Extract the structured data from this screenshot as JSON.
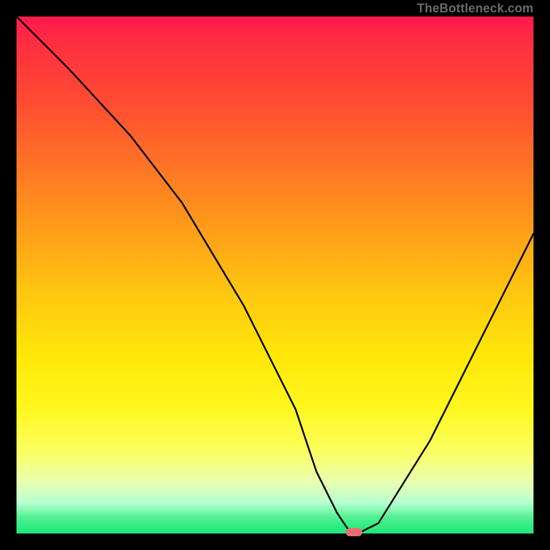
{
  "watermark": "TheBottleneck.com",
  "chart_data": {
    "type": "line",
    "title": "",
    "xlabel": "",
    "ylabel": "",
    "xlim": [
      0,
      100
    ],
    "ylim": [
      0,
      100
    ],
    "grid": false,
    "legend": false,
    "series": [
      {
        "name": "curve",
        "x": [
          0,
          10,
          22,
          32,
          44,
          54,
          58,
          62,
          64,
          66,
          70,
          80,
          90,
          100
        ],
        "y": [
          100,
          90,
          77,
          64,
          44,
          24,
          12,
          4,
          1,
          0,
          2,
          18,
          38,
          58
        ]
      }
    ],
    "marker": {
      "x": 65,
      "y": 0.8,
      "color": "#e87070"
    }
  }
}
